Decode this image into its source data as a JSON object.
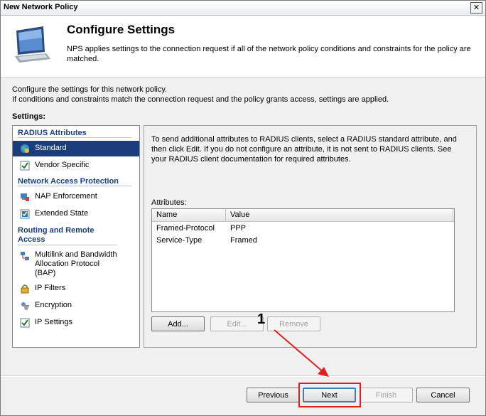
{
  "window": {
    "title": "New Network Policy",
    "close_glyph": "✕"
  },
  "header": {
    "title": "Configure Settings",
    "description": "NPS applies settings to the connection request if all of the network policy conditions and constraints for the policy are matched.",
    "icon": "monitor-icon"
  },
  "intro": {
    "line1": "Configure the settings for this network policy.",
    "line2": "If conditions and constraints match the connection request and the policy grants access, settings are applied."
  },
  "settings_label": "Settings:",
  "sidebar": {
    "sections": [
      {
        "label": "RADIUS Attributes"
      },
      {
        "label": "Network Access Protection"
      },
      {
        "label": "Routing and Remote Access"
      }
    ],
    "items": [
      {
        "label": "Standard",
        "icon": "globe-icon",
        "selected": true
      },
      {
        "label": "Vendor Specific",
        "icon": "checklist-icon"
      },
      {
        "label": "NAP Enforcement",
        "icon": "nap-icon"
      },
      {
        "label": "Extended State",
        "icon": "checklist-icon"
      },
      {
        "label": "Multilink and Bandwidth Allocation Protocol (BAP)",
        "icon": "network-icon"
      },
      {
        "label": "IP Filters",
        "icon": "lock-icon"
      },
      {
        "label": "Encryption",
        "icon": "keys-icon"
      },
      {
        "label": "IP Settings",
        "icon": "checklist-icon"
      }
    ]
  },
  "main": {
    "description": "To send additional attributes to RADIUS clients, select a RADIUS standard attribute, and then click Edit. If you do not configure an attribute, it is not sent to RADIUS clients. See your RADIUS client documentation for required attributes.",
    "attributes_label": "Attributes:",
    "columns": [
      "Name",
      "Value"
    ],
    "rows": [
      {
        "name": "Framed-Protocol",
        "value": "PPP"
      },
      {
        "name": "Service-Type",
        "value": "Framed"
      }
    ],
    "buttons": {
      "add": "Add...",
      "edit": "Edit...",
      "remove": "Remove"
    }
  },
  "footer": {
    "previous": "Previous",
    "next": "Next",
    "finish": "Finish",
    "cancel": "Cancel"
  },
  "annotation": {
    "step": "1",
    "color": "#e02020"
  }
}
